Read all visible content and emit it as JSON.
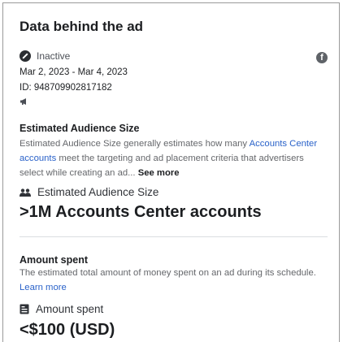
{
  "panel": {
    "title": "Data behind the ad",
    "status": "Inactive",
    "date_range": "Mar 2, 2023 - Mar 4, 2023",
    "id_text": "ID: 948709902817182",
    "platform_icon": "facebook-icon"
  },
  "audience": {
    "heading": "Estimated Audience Size",
    "desc_pre": "Estimated Audience Size generally estimates how many ",
    "desc_link": "Accounts Center accounts",
    "desc_post": " meet the targeting and ad placement criteria that advertisers select while creating an ad... ",
    "see_more": "See more",
    "label": "Estimated Audience Size",
    "label_icon": "people-icon",
    "value": ">1M Accounts Center accounts"
  },
  "spend": {
    "heading": "Amount spent",
    "desc": "The estimated total amount of money spent on an ad during its schedule.",
    "learn_more": "Learn more",
    "label": "Amount spent",
    "label_icon": "receipt-icon",
    "value": "<$100 (USD)"
  },
  "colors": {
    "link": "#2a62c9",
    "muted": "#65676b",
    "text": "#1c1e21"
  }
}
